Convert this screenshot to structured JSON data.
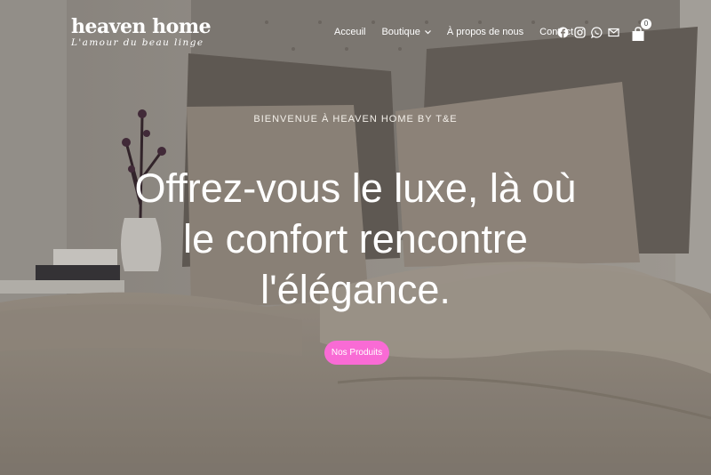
{
  "brand": {
    "name": "heaven home",
    "tagline": "L'amour du beau linge"
  },
  "nav": {
    "items": [
      {
        "label": "Acceuil"
      },
      {
        "label": "Boutique",
        "has_dropdown": true
      },
      {
        "label": "À propos de nous"
      },
      {
        "label": "Contact"
      }
    ]
  },
  "social_icons": [
    "facebook-icon",
    "instagram-icon",
    "whatsapp-icon",
    "mail-icon"
  ],
  "cart": {
    "count": "0"
  },
  "hero": {
    "welcome": "BIENVENUE À HEAVEN HOME BY T&E",
    "headline_lines": [
      "Offrez-vous le luxe, là où",
      "le confort rencontre",
      "l'élégance."
    ],
    "cta_label": "Nos Produits"
  },
  "colors": {
    "accent": "#f96bd5",
    "text": "#ffffff"
  }
}
